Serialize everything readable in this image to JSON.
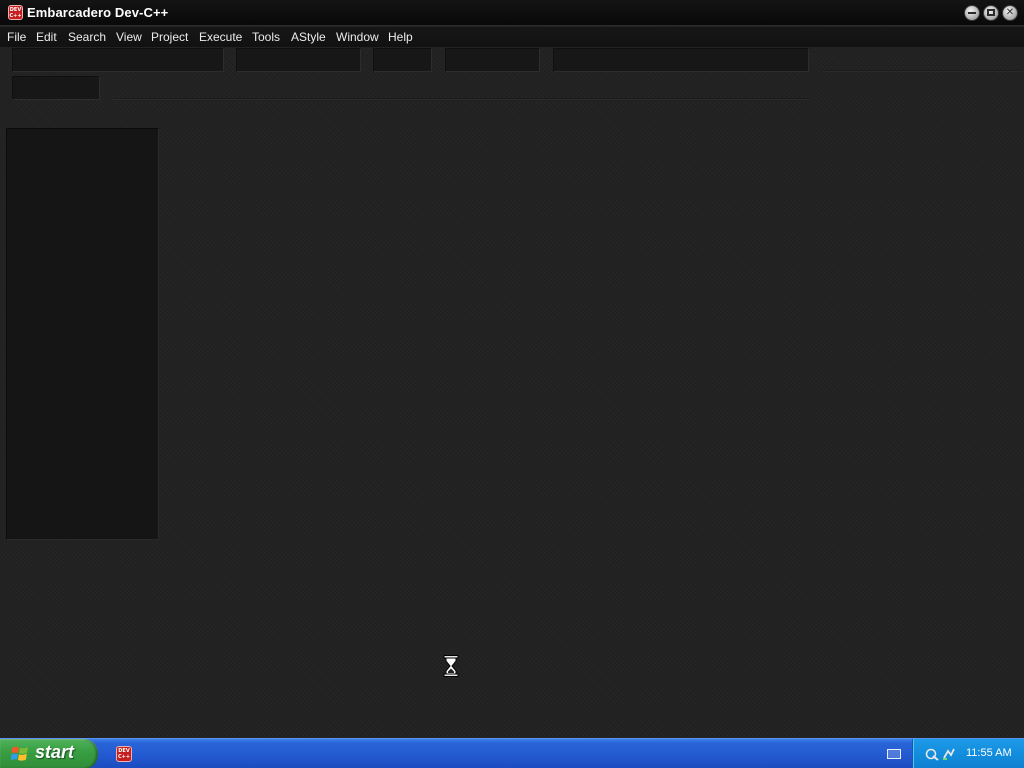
{
  "window": {
    "title": "Embarcadero Dev-C++",
    "logo_text": "DEV C++"
  },
  "menu": {
    "items": [
      {
        "label": "File"
      },
      {
        "label": "Edit"
      },
      {
        "label": "Search"
      },
      {
        "label": "View"
      },
      {
        "label": "Project"
      },
      {
        "label": "Execute"
      },
      {
        "label": "Tools"
      },
      {
        "label": "AStyle"
      },
      {
        "label": "Window"
      },
      {
        "label": "Help"
      }
    ]
  },
  "taskbar": {
    "start_label": "start",
    "tasks": [
      {
        "icon": "devcpp-icon"
      }
    ],
    "tray_icons": [
      "keyboard-icon",
      "network-icon",
      "connection-icon"
    ],
    "clock": "11:55 AM"
  },
  "cursor": {
    "icon": "hourglass-icon"
  },
  "colors": {
    "background": "#222222",
    "titlebar": "#0d0d0d",
    "taskbar": "#235ad1",
    "start_button": "#3a9f43",
    "tray": "#138ddd",
    "logo": "#c41e1e"
  }
}
